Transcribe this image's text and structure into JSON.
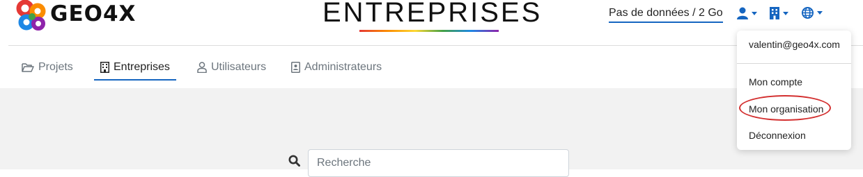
{
  "brand": {
    "logo_text": "GEO4X"
  },
  "header": {
    "title": "ENTREPRISES",
    "storage_text": "Pas de données / 2 Go",
    "icons": [
      "user-icon",
      "building-icon",
      "globe-icon"
    ],
    "accent_color": "#1565c0"
  },
  "tabs": [
    {
      "label": "Projets",
      "icon": "folder-open-icon",
      "active": false
    },
    {
      "label": "Entreprises",
      "icon": "building-icon",
      "active": true
    },
    {
      "label": "Utilisateurs",
      "icon": "user-icon",
      "active": false
    },
    {
      "label": "Administrateurs",
      "icon": "id-badge-icon",
      "active": false
    }
  ],
  "search": {
    "placeholder": "Recherche",
    "value": ""
  },
  "user_menu": {
    "email": "valentin@geo4x.com",
    "items": [
      "Mon compte",
      "Mon organisation",
      "Déconnexion"
    ],
    "highlight_color": "#d32f2f"
  }
}
